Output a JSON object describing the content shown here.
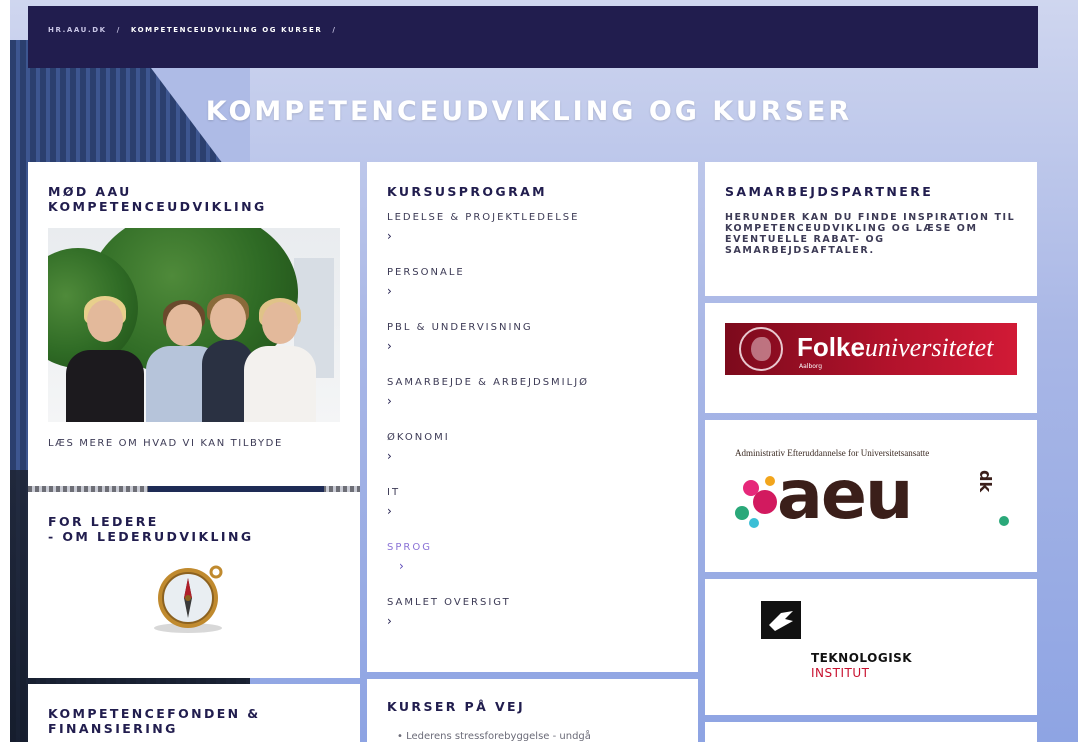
{
  "breadcrumb": {
    "home": "HR.AAU.DK",
    "sep1": "/",
    "current": "KOMPETENCEUDVIKLING OG KURSER",
    "sep2": "/"
  },
  "page_title": "KOMPETENCEUDVIKLING OG KURSER",
  "col1": {
    "meet": {
      "title": "MØD AAU KOMPETENCEUDVIKLING",
      "link": "LÆS MERE OM HVAD VI KAN TILBYDE"
    },
    "leaders": {
      "title": "FOR LEDERE\n- OM LEDERUDVIKLING"
    },
    "fund": {
      "title": "KOMPETENCEFONDEN & FINANSIERING"
    }
  },
  "col2": {
    "program": {
      "title": "KURSUSPROGRAM",
      "arrow": "›",
      "items": [
        {
          "label": "LEDELSE & PROJEKTLEDELSE"
        },
        {
          "label": "PERSONALE"
        },
        {
          "label": "PBL & UNDERVISNING"
        },
        {
          "label": "SAMARBEJDE & ARBEJDSMILJØ"
        },
        {
          "label": "ØKONOMI"
        },
        {
          "label": "IT"
        },
        {
          "label": "SPROG"
        },
        {
          "label": "SAMLET OVERSIGT"
        }
      ]
    },
    "upcoming": {
      "title": "KURSER PÅ VEJ",
      "items": [
        "• Lederens stressforebyggelse - undgå"
      ]
    }
  },
  "col3": {
    "partners": {
      "title": "SAMARBEJDSPARTNERE",
      "text": "HERUNDER KAN DU FINDE INSPIRATION TIL KOMPETENCEUDVIKLING OG LÆSE OM EVENTUELLE RABAT- OG SAMARBEJDSAFTALER."
    },
    "folke": {
      "name_bold": "Folke",
      "name_italic": "universitetet",
      "sub": "Aalborg"
    },
    "aeu": {
      "tagline": "Administrativ Efteruddannelse for Universitetsansatte",
      "word": "aeu",
      "dk": "dk"
    },
    "ti": {
      "name": "TEKNOLOGISK",
      "sub": "INSTITUT"
    }
  },
  "colors": {
    "header_bg": "#211d4e",
    "title_text": "#211d4e",
    "active_link": "#8a72d6",
    "folke_red": "#b1122b",
    "ti_red": "#c8102e"
  }
}
